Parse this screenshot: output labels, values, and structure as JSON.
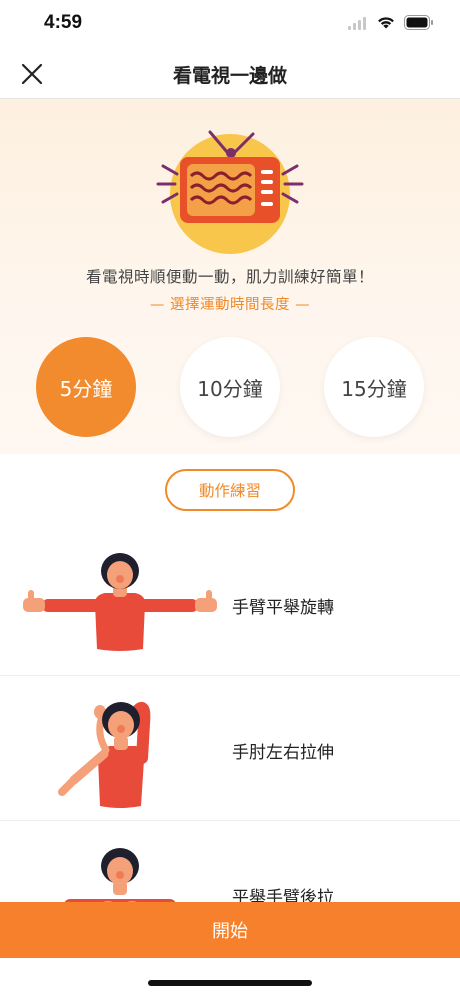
{
  "status_bar": {
    "time": "4:59",
    "icons": [
      "signal-icon",
      "wifi-icon",
      "battery-icon"
    ]
  },
  "nav": {
    "title": "看電視一邊做",
    "close_icon": "close-icon"
  },
  "hero": {
    "description": "看電視時順便動一動，肌力訓練好簡單！",
    "subtitle": "— 選擇運動時間長度 —"
  },
  "durations": [
    {
      "label": "5分鐘",
      "selected": true
    },
    {
      "label": "10分鐘",
      "selected": false
    },
    {
      "label": "15分鐘",
      "selected": false
    }
  ],
  "practice_button": "動作練習",
  "exercises": [
    {
      "label": "手臂平舉旋轉"
    },
    {
      "label": "手肘左右拉伸"
    },
    {
      "label": "平舉手臂後拉"
    }
  ],
  "start_button": "開始",
  "colors": {
    "accent": "#f6802b",
    "hero_bg": "#fdf0df",
    "tv_red": "#e8502a",
    "tv_circle": "#f8c64a",
    "figure_red": "#e84b3a",
    "skin": "#f4a078"
  }
}
